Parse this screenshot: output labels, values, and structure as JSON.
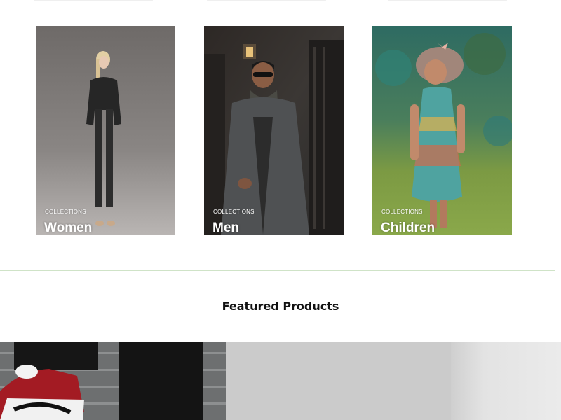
{
  "collections": [
    {
      "eyebrow": "COLLECTIONS",
      "title": "Women",
      "image": "woman-in-black-suit-photo"
    },
    {
      "eyebrow": "COLLECTIONS",
      "title": "Men",
      "image": "man-in-grey-coat-photo"
    },
    {
      "eyebrow": "COLLECTIONS",
      "title": "Children",
      "image": "girl-in-floral-dress-photo"
    }
  ],
  "featured": {
    "heading": "Featured Products",
    "products": [
      {
        "image": "red-white-sneaker-photo"
      },
      {
        "image": "grey-product-placeholder"
      },
      {
        "image": "light-grey-product-photo"
      }
    ]
  },
  "colors": {
    "divider": "#cfe3c7",
    "heading": "#111111",
    "card_text": "#ffffff"
  }
}
